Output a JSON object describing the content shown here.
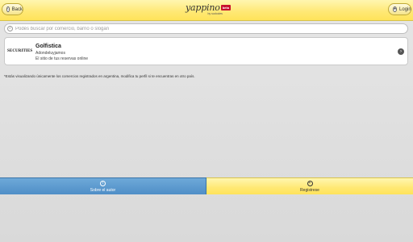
{
  "header": {
    "back_label": "Back",
    "login_label": "Login",
    "logo_text": "yappino",
    "logo_badge": "beta",
    "logo_sub": "by sudocles"
  },
  "search": {
    "placeholder": "Podés buscar por comercio, barrio o slogan"
  },
  "results": [
    {
      "logo_text": "SECURITIES",
      "title": "Golfistica",
      "line1": "Adondeluyjamos",
      "line2": "El sitio de tus reservas online"
    }
  ],
  "notice": "*Estás visualizando únicamente los comercios registrados en argentina, modifica tu perfil si te encuentras en otro país.",
  "bottom_tabs": {
    "about_label": "Sobre el autor",
    "register_label": "Registrese"
  },
  "colors": {
    "header_yellow": "#ffe873",
    "about_blue": "#5b97cc",
    "badge_red": "#c8102e"
  },
  "icons": {
    "back": "chevron-left-icon",
    "login": "user-icon",
    "search": "search-icon",
    "arrow": "chevron-right-icon",
    "about": "info-icon",
    "register": "register-icon"
  }
}
